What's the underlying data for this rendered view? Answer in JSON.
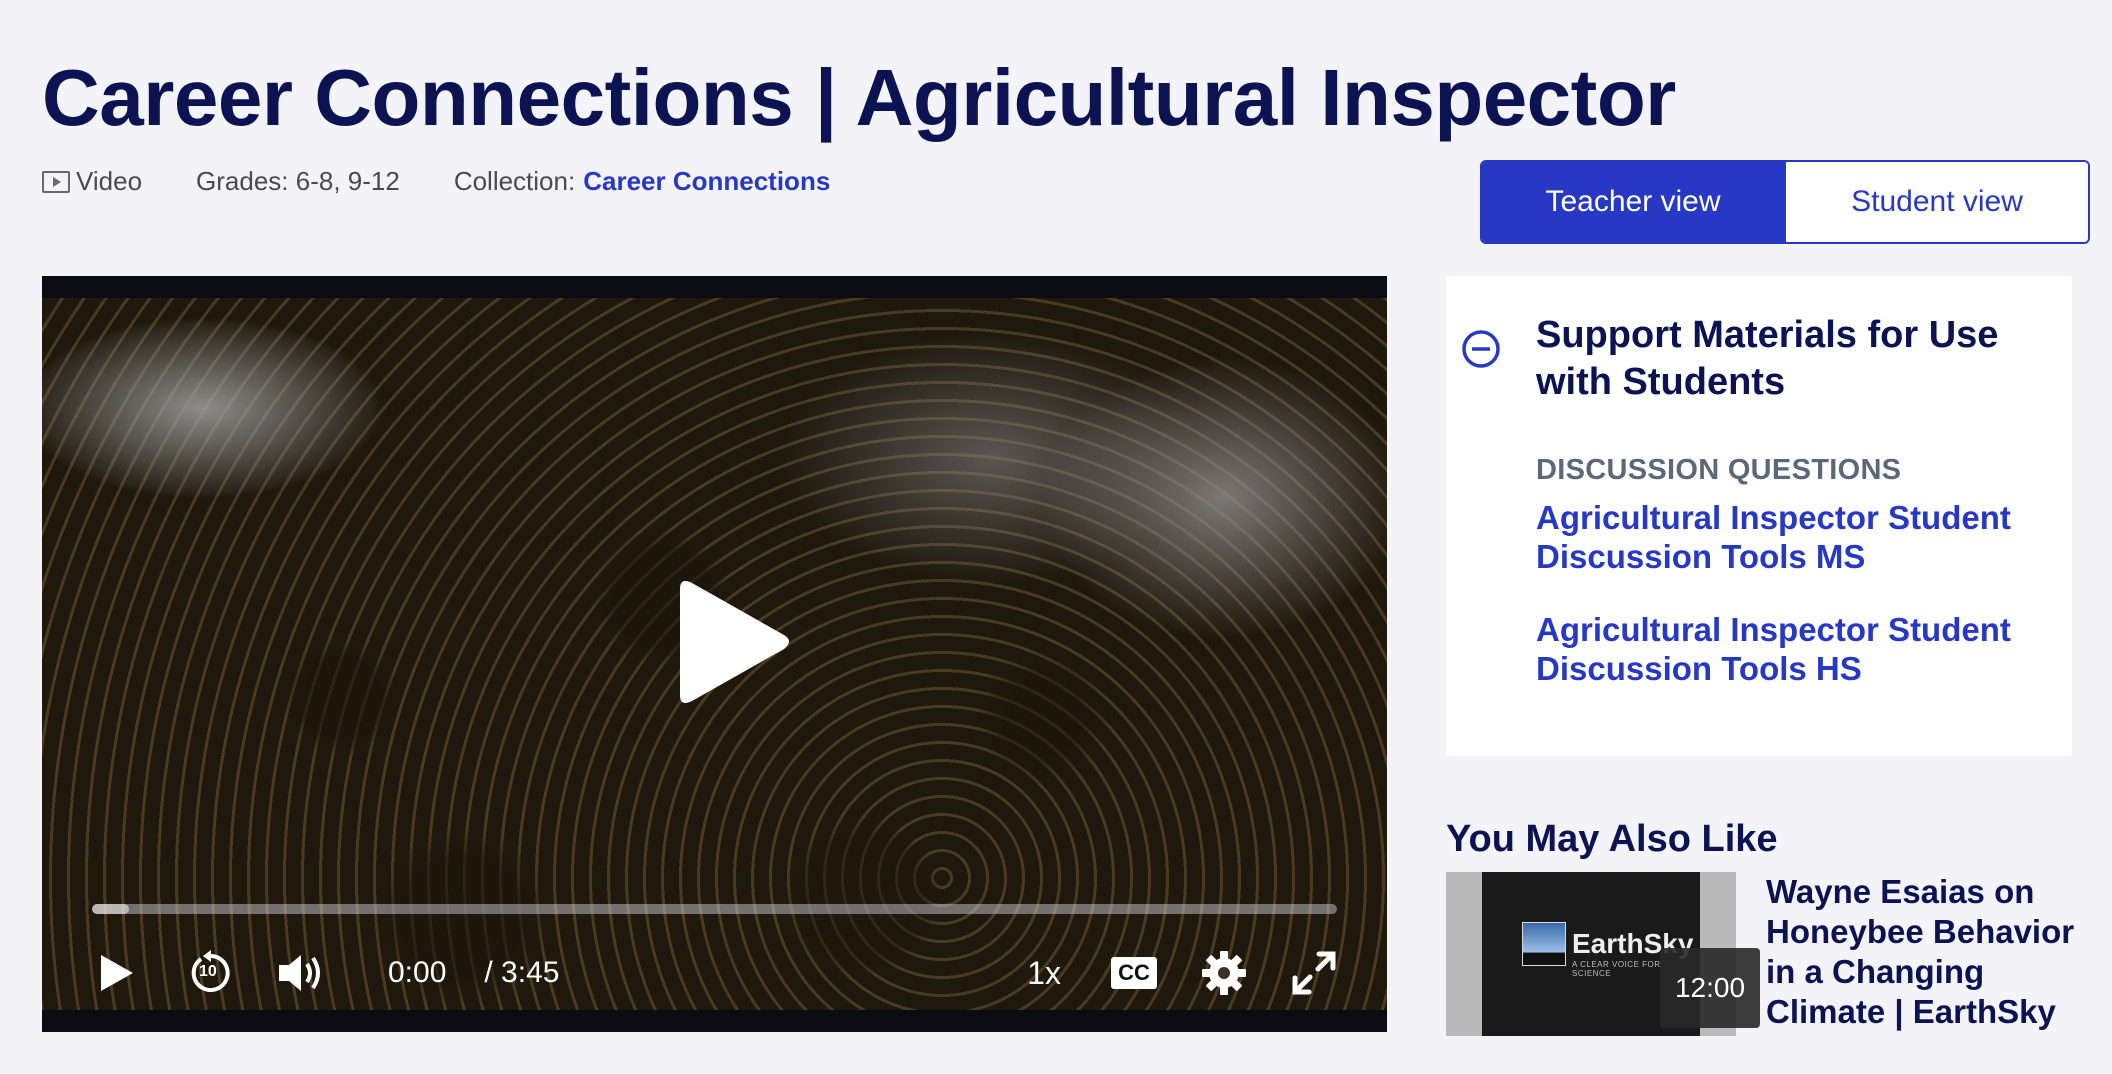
{
  "page": {
    "title": "Career Connections | Agricultural Inspector"
  },
  "meta": {
    "type_label": "Video",
    "grades": "Grades: 6-8, 9-12",
    "collection_label": "Collection:",
    "collection_link": "Career Connections"
  },
  "view_toggle": {
    "teacher": "Teacher view",
    "student": "Student view",
    "active": "teacher"
  },
  "player": {
    "current_time": "0:00",
    "duration": "/ 3:45",
    "speed": "1x",
    "cc_label": "CC",
    "rewind_seconds": "10",
    "progress": 0.03
  },
  "support": {
    "heading": "Support Materials for Use with Students",
    "section_label": "DISCUSSION QUESTIONS",
    "links": [
      "Agricultural Inspector Student Discussion Tools MS",
      "Agricultural Inspector Student Discussion Tools HS"
    ]
  },
  "also_like": {
    "heading": "You May Also Like",
    "items": [
      {
        "title": "Wayne Esaias on Honeybee Behavior in a Changing Climate | EarthSky",
        "duration": "12:00",
        "thumb_logo": "EarthSky",
        "thumb_tagline": "A CLEAR VOICE FOR SCIENCE"
      }
    ]
  },
  "colors": {
    "navy": "#0c1353",
    "accent": "#2638c4",
    "background": "#f4f4f8"
  }
}
